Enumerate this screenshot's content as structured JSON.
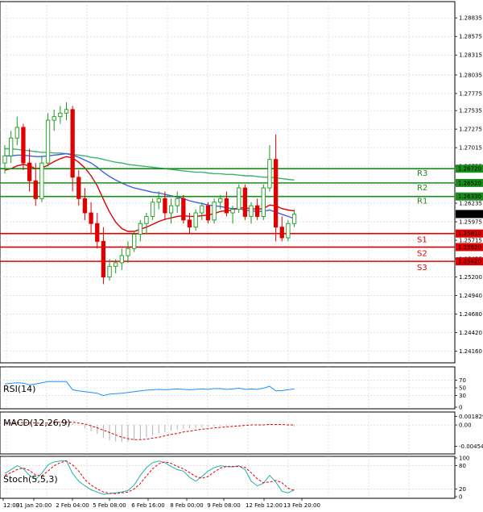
{
  "chart_data": {
    "type": "candlestick",
    "main": {
      "ylim": [
        1.2403,
        1.2903
      ],
      "yticks": [
        "1.28835",
        "1.28575",
        "1.28315",
        "1.28035",
        "1.27775",
        "1.27535",
        "1.27275",
        "1.27015",
        "1.26755",
        "1.26495",
        "1.26235",
        "1.25975",
        "1.25715",
        "1.25455",
        "1.25200",
        "1.24940",
        "1.24680",
        "1.24420",
        "1.24160"
      ],
      "xticks": [
        "12:00",
        "31 Jan 20:00",
        "2 Feb 04:00",
        "5 Feb 08:00",
        "6 Feb 16:00",
        "8 Feb 00:00",
        "9 Feb 08:00",
        "12 Feb 12:00",
        "13 Feb 20:00"
      ],
      "current_price": "1.26084",
      "levels": [
        {
          "name": "R3",
          "value": "1.26720",
          "color": "#1a8c1a"
        },
        {
          "name": "R2",
          "value": "1.26520",
          "color": "#1a8c1a"
        },
        {
          "name": "R1",
          "value": "1.26330",
          "color": "#1a8c1a"
        },
        {
          "name": "S1",
          "value": "1.25810",
          "color": "#e00000"
        },
        {
          "name": "S2",
          "value": "1.25620",
          "color": "#e00000"
        },
        {
          "name": "S3",
          "value": "1.25420",
          "color": "#e00000"
        }
      ],
      "candles": [
        [
          1.268,
          1.2705,
          1.2665,
          1.269
        ],
        [
          1.269,
          1.2725,
          1.268,
          1.2715
        ],
        [
          1.2715,
          1.2745,
          1.2705,
          1.273
        ],
        [
          1.273,
          1.2735,
          1.267,
          1.268
        ],
        [
          1.268,
          1.27,
          1.264,
          1.2655
        ],
        [
          1.2655,
          1.268,
          1.262,
          1.263
        ],
        [
          1.263,
          1.269,
          1.2625,
          1.268
        ],
        [
          1.268,
          1.275,
          1.2675,
          1.274
        ],
        [
          1.274,
          1.2755,
          1.2725,
          1.2745
        ],
        [
          1.2745,
          1.276,
          1.2735,
          1.275
        ],
        [
          1.275,
          1.2765,
          1.274,
          1.2755
        ],
        [
          1.2755,
          1.276,
          1.264,
          1.266
        ],
        [
          1.266,
          1.267,
          1.262,
          1.263
        ],
        [
          1.263,
          1.2645,
          1.26,
          1.261
        ],
        [
          1.261,
          1.2625,
          1.258,
          1.2595
        ],
        [
          1.2595,
          1.261,
          1.256,
          1.257
        ],
        [
          1.257,
          1.259,
          1.251,
          1.252
        ],
        [
          1.252,
          1.2545,
          1.2515,
          1.2535
        ],
        [
          1.2535,
          1.2545,
          1.2525,
          1.254
        ],
        [
          1.254,
          1.256,
          1.253,
          1.255
        ],
        [
          1.255,
          1.257,
          1.254,
          1.256
        ],
        [
          1.256,
          1.2585,
          1.2555,
          1.258
        ],
        [
          1.258,
          1.26,
          1.257,
          1.2595
        ],
        [
          1.2595,
          1.261,
          1.258,
          1.2605
        ],
        [
          1.2605,
          1.263,
          1.26,
          1.2625
        ],
        [
          1.2625,
          1.264,
          1.2615,
          1.263
        ],
        [
          1.263,
          1.264,
          1.26,
          1.261
        ],
        [
          1.261,
          1.263,
          1.2595,
          1.262
        ],
        [
          1.262,
          1.264,
          1.261,
          1.263
        ],
        [
          1.263,
          1.2635,
          1.2595,
          1.26
        ],
        [
          1.26,
          1.261,
          1.258,
          1.259
        ],
        [
          1.259,
          1.2615,
          1.2585,
          1.261
        ],
        [
          1.261,
          1.2625,
          1.26,
          1.262
        ],
        [
          1.262,
          1.2625,
          1.2595,
          1.26
        ],
        [
          1.26,
          1.263,
          1.2595,
          1.2625
        ],
        [
          1.2625,
          1.2635,
          1.2615,
          1.263
        ],
        [
          1.263,
          1.264,
          1.2605,
          1.261
        ],
        [
          1.261,
          1.262,
          1.2595,
          1.2615
        ],
        [
          1.2615,
          1.265,
          1.261,
          1.2645
        ],
        [
          1.2645,
          1.265,
          1.26,
          1.2605
        ],
        [
          1.2605,
          1.2625,
          1.2595,
          1.262
        ],
        [
          1.262,
          1.263,
          1.26,
          1.2605
        ],
        [
          1.2605,
          1.265,
          1.26,
          1.2645
        ],
        [
          1.2645,
          1.2705,
          1.264,
          1.2685
        ],
        [
          1.2685,
          1.272,
          1.257,
          1.259
        ],
        [
          1.259,
          1.2605,
          1.257,
          1.2575
        ],
        [
          1.2575,
          1.26,
          1.257,
          1.2595
        ],
        [
          1.2595,
          1.2615,
          1.259,
          1.2608
        ]
      ],
      "ma_red": [
        1.267,
        1.2672,
        1.2676,
        1.2678,
        1.2676,
        1.2672,
        1.2673,
        1.2677,
        1.2682,
        1.2686,
        1.2689,
        1.2687,
        1.2681,
        1.2673,
        1.2662,
        1.2648,
        1.2629,
        1.2611,
        1.2597,
        1.2588,
        1.2584,
        1.2584,
        1.2587,
        1.259,
        1.2594,
        1.2598,
        1.2601,
        1.2603,
        1.2605,
        1.2606,
        1.2605,
        1.2605,
        1.2606,
        1.2607,
        1.2609,
        1.2612,
        1.2613,
        1.2614,
        1.2617,
        1.2617,
        1.2616,
        1.2615,
        1.2616,
        1.2621,
        1.262,
        1.2616,
        1.2614,
        1.2613
      ],
      "ma_blue": [
        1.269,
        1.269,
        1.2691,
        1.2691,
        1.269,
        1.2689,
        1.2689,
        1.269,
        1.2691,
        1.2692,
        1.2693,
        1.2691,
        1.2688,
        1.2684,
        1.268,
        1.2674,
        1.2667,
        1.2661,
        1.2656,
        1.2652,
        1.2648,
        1.2645,
        1.2643,
        1.2641,
        1.2639,
        1.2638,
        1.2636,
        1.2634,
        1.2632,
        1.263,
        1.2627,
        1.2625,
        1.2623,
        1.2621,
        1.262,
        1.2619,
        1.2617,
        1.2616,
        1.2616,
        1.2614,
        1.2613,
        1.2612,
        1.2612,
        1.2614,
        1.2611,
        1.2608,
        1.2605,
        1.2602
      ],
      "ma_green": [
        1.27,
        1.27,
        1.2699,
        1.2698,
        1.2697,
        1.2696,
        1.2695,
        1.2695,
        1.2694,
        1.2694,
        1.2693,
        1.2692,
        1.2691,
        1.269,
        1.2688,
        1.2687,
        1.2685,
        1.2683,
        1.2681,
        1.268,
        1.2678,
        1.2677,
        1.2676,
        1.2675,
        1.2674,
        1.2673,
        1.2672,
        1.2671,
        1.267,
        1.2669,
        1.2668,
        1.2667,
        1.2667,
        1.2666,
        1.2665,
        1.2665,
        1.2664,
        1.2664,
        1.2663,
        1.2662,
        1.2662,
        1.2661,
        1.266,
        1.266,
        1.2659,
        1.2658,
        1.2657,
        1.2656
      ]
    },
    "rsi": {
      "label": "RSI(14)",
      "ylim": [
        0,
        100
      ],
      "yticks": [
        "70",
        "50",
        "30",
        "0"
      ],
      "values": [
        60,
        62,
        63,
        62,
        58,
        60,
        63,
        66,
        66,
        66,
        66,
        45,
        42,
        40,
        38,
        36,
        30,
        34,
        35,
        36,
        38,
        40,
        42,
        44,
        45,
        46,
        45,
        46,
        47,
        46,
        45,
        46,
        47,
        46,
        48,
        48,
        46,
        47,
        49,
        46,
        47,
        46,
        49,
        54,
        42,
        43,
        45,
        47
      ]
    },
    "macd": {
      "label": "MACD(12,26,9)",
      "yticks": [
        "0.001829",
        "0.00",
        "-0.004542"
      ],
      "ylim": [
        -0.0058,
        0.0024
      ],
      "hist": [
        0.0005,
        0.0006,
        0.0007,
        0.0006,
        0.0004,
        0.0002,
        0.0003,
        0.0005,
        0.0007,
        0.0008,
        0.0008,
        0.0004,
        -0.0001,
        -0.0007,
        -0.0013,
        -0.0019,
        -0.0027,
        -0.0032,
        -0.0035,
        -0.0036,
        -0.0035,
        -0.0033,
        -0.003,
        -0.0026,
        -0.0022,
        -0.0018,
        -0.0015,
        -0.0012,
        -0.001,
        -0.0008,
        -0.0007,
        -0.0006,
        -0.0005,
        -0.0004,
        -0.0003,
        -0.0002,
        -0.0002,
        -0.0001,
        0.0,
        0.0,
        0.0,
        0.0,
        0.0001,
        0.0003,
        0.0001,
        -0.0001,
        -0.0002,
        -0.0003
      ],
      "signal": [
        0.0004,
        0.0004,
        0.0005,
        0.0005,
        0.0005,
        0.0004,
        0.0004,
        0.0004,
        0.0005,
        0.0006,
        0.0006,
        0.0006,
        0.0004,
        0.0002,
        -0.0002,
        -0.0006,
        -0.0011,
        -0.0016,
        -0.0021,
        -0.0026,
        -0.0029,
        -0.0031,
        -0.0031,
        -0.003,
        -0.0028,
        -0.0026,
        -0.0023,
        -0.002,
        -0.0018,
        -0.0015,
        -0.0013,
        -0.0011,
        -0.0009,
        -0.0008,
        -0.0006,
        -0.0005,
        -0.0004,
        -0.0003,
        -0.0002,
        -0.0001,
        0.0,
        0.0,
        0.0,
        0.0001,
        0.0001,
        0.0001,
        0.0,
        0.0
      ]
    },
    "stoch": {
      "label": "Stoch(5,5,3)",
      "ylim": [
        0,
        100
      ],
      "yticks": [
        "100",
        "80",
        "20",
        "0"
      ],
      "main": [
        60,
        70,
        80,
        72,
        55,
        45,
        60,
        82,
        90,
        92,
        93,
        60,
        40,
        28,
        18,
        12,
        6,
        8,
        10,
        12,
        16,
        30,
        55,
        75,
        88,
        92,
        88,
        78,
        70,
        66,
        50,
        40,
        52,
        66,
        75,
        80,
        78,
        77,
        80,
        70,
        40,
        28,
        35,
        55,
        38,
        14,
        10,
        18
      ],
      "signal": [
        55,
        62,
        70,
        74,
        68,
        56,
        54,
        66,
        80,
        88,
        92,
        82,
        66,
        44,
        30,
        20,
        12,
        9,
        8,
        10,
        12,
        20,
        34,
        54,
        72,
        85,
        90,
        86,
        78,
        72,
        62,
        52,
        48,
        52,
        64,
        74,
        78,
        78,
        78,
        76,
        62,
        46,
        36,
        38,
        42,
        36,
        22,
        16
      ]
    }
  }
}
